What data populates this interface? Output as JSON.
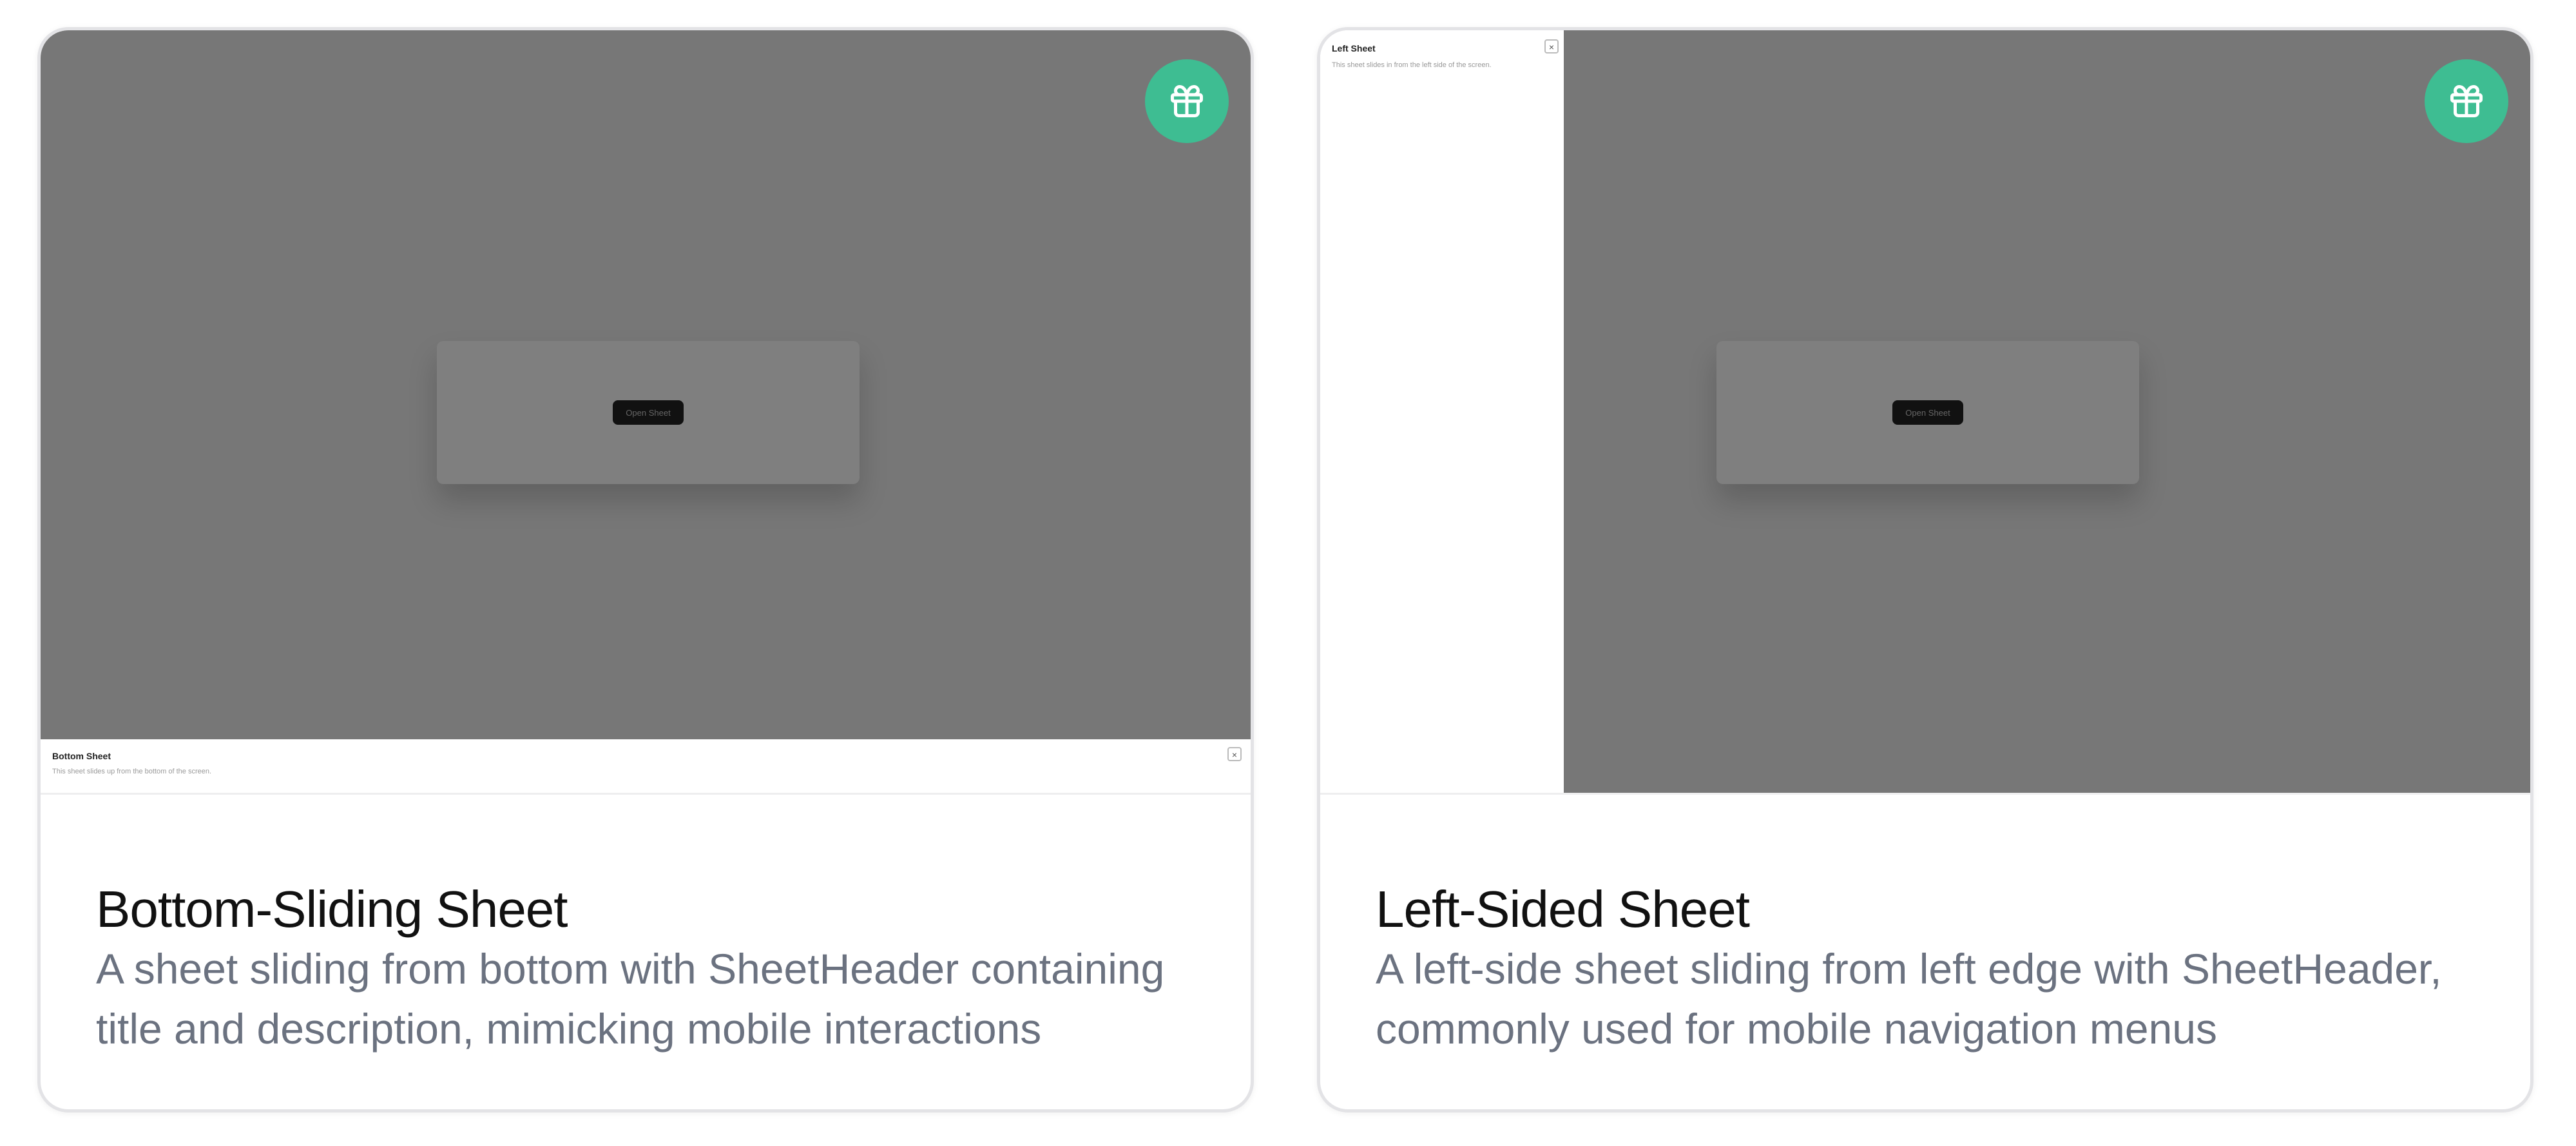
{
  "colors": {
    "accent": "#3ebd92",
    "overlay": "#777777",
    "text_muted": "#6b7280"
  },
  "cards": [
    {
      "title": "Bottom-Sliding Sheet",
      "description": "A sheet sliding from bottom with SheetHeader containing title and description, mimicking mobile interactions",
      "preview": {
        "button_label": "Open Sheet",
        "sheet_title": "Bottom Sheet",
        "sheet_description": "This sheet slides up from the bottom of the screen.",
        "close_glyph": "×",
        "badge_icon": "gift-icon"
      }
    },
    {
      "title": "Left-Sided Sheet",
      "description": "A left-side sheet sliding from left edge with SheetHeader, commonly used for mobile navigation menus",
      "preview": {
        "button_label": "Open Sheet",
        "sheet_title": "Left Sheet",
        "sheet_description": "This sheet slides in from the left side of the screen.",
        "close_glyph": "×",
        "badge_icon": "gift-icon"
      }
    }
  ]
}
